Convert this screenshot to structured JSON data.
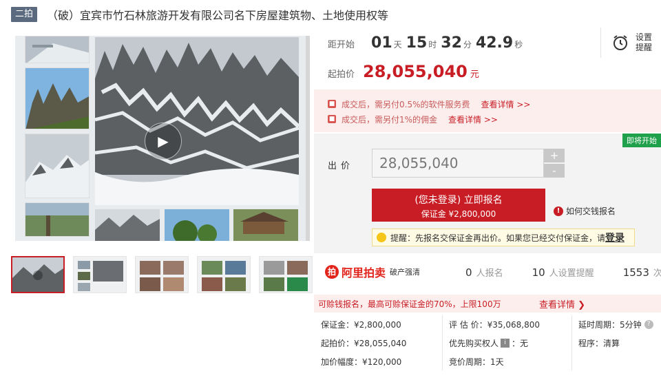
{
  "header": {
    "tag": "二拍",
    "title": "（破）宜宾市竹石林旅游开发有限公司名下房屋建筑物、土地使用权等"
  },
  "countdown": {
    "label": "距开始",
    "days": "01",
    "days_unit": "天",
    "hours": "15",
    "hours_unit": "时",
    "minutes": "32",
    "minutes_unit": "分",
    "seconds": "42.9",
    "seconds_unit": "秒"
  },
  "start_price": {
    "label": "起拍价",
    "value": "28,055,040",
    "unit": "元"
  },
  "reminder": {
    "line1": "设置",
    "line2": "提醒",
    "icon": "alarm-clock-icon"
  },
  "notices": [
    {
      "text": "成交后，需另付0.5%的软件服务费",
      "link": "查看详情 >>"
    },
    {
      "text": "成交后，需另付1%的佣金",
      "link": "查看详情 >>"
    }
  ],
  "bid": {
    "badge": "即将开始",
    "label": "出价",
    "value": "28,055,040",
    "plus": "+",
    "minus": "-",
    "signup_line1": "(您未登录) 立即报名",
    "signup_line2": "保证金 ¥2,800,000",
    "howto": "如何交钱报名",
    "tip_text": "提醒：先报名交保证金再出价。如果您已经交付保证金，请",
    "tip_link": "登录"
  },
  "stats": {
    "logo_text": "阿里拍卖",
    "logo_sub": "破产强清",
    "signups": "0",
    "signups_label": "人报名",
    "reminders": "10",
    "reminders_label": "人设置提醒",
    "views": "1553",
    "views_label": "次围观"
  },
  "deposit_bar": {
    "text": "可赊钱报名，最高可赊保证金的70%，上限100万",
    "link": "查看详情 ❯"
  },
  "details": {
    "deposit": "保证金：¥2,800,000",
    "start_price": "起拍价：¥28,055,040",
    "increment": "加价幅度：¥120,000",
    "valuation": "评 估 价：¥35,068,800",
    "priority": "优先购买权人",
    "priority_value": "：无",
    "cycle": "竞价周期：1天",
    "delay": "延时周期：5分钟",
    "procedure": "程序：清算"
  },
  "colors": {
    "accent": "#c81d24",
    "notice_bg": "#fdeeee",
    "badge_green": "#1fa04b"
  }
}
